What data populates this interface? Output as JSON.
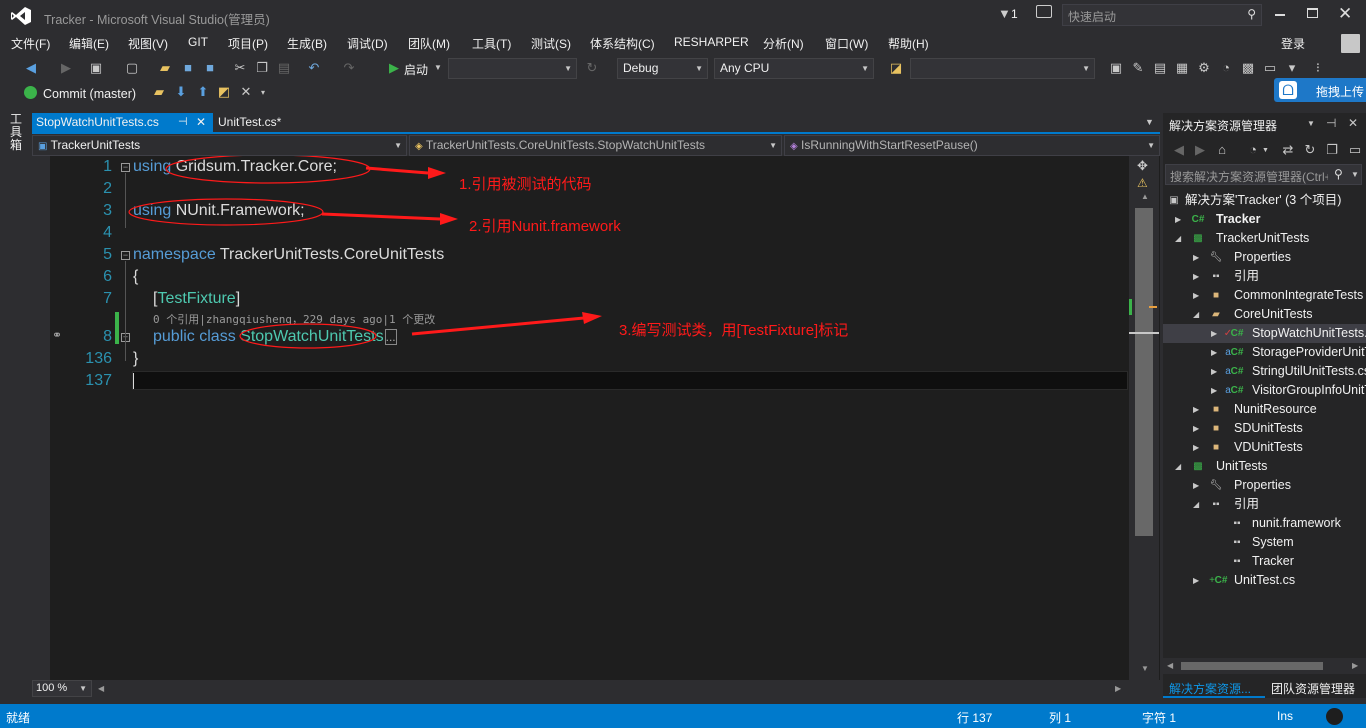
{
  "titlebar": {
    "title": "Tracker - Microsoft Visual Studio(管理员)",
    "notification_count": "1",
    "quick_launch_placeholder": "快速启动"
  },
  "menu": [
    "文件(F)",
    "编辑(E)",
    "视图(V)",
    "GIT",
    "项目(P)",
    "生成(B)",
    "调试(D)",
    "团队(M)",
    "工具(T)",
    "测试(S)",
    "体系结构(C)",
    "RESHARPER",
    "分析(N)",
    "窗口(W)",
    "帮助(H)"
  ],
  "account": {
    "signin": "登录"
  },
  "toolbar": {
    "start_label": "启动",
    "config": "Debug",
    "platform": "Any CPU"
  },
  "git_toolbar": {
    "commit_label": "Commit (master)"
  },
  "upload_badge": "拖拽上传",
  "left_tool_label": "工具箱",
  "tabs": [
    {
      "label": "StopWatchUnitTests.cs",
      "active": true
    },
    {
      "label": "UnitTest.cs*",
      "active": false
    }
  ],
  "navbar": {
    "project": "TrackerUnitTests",
    "class": "TrackerUnitTests.CoreUnitTests.StopWatchUnitTests",
    "member": "IsRunningWithStartResetPause()"
  },
  "code": {
    "line_numbers": [
      "1",
      "2",
      "3",
      "4",
      "5",
      "6",
      "7",
      "8",
      "136",
      "137"
    ],
    "line1_kw": "using",
    "line1_rest": " Gridsum.Tracker.Core;",
    "line3_kw": "using",
    "line3_rest": " NUnit.Framework;",
    "line5_kw": "namespace",
    "line5_rest": " TrackerUnitTests.CoreUnitTests",
    "line6": "{",
    "line7_open": "[",
    "line7_attr": "TestFixture",
    "line7_close": "]",
    "codelens": "0 个引用|zhangqiusheng，229 days ago|1 个更改",
    "line8_kw": "public class",
    "line8_type": "StopWatchUnitTests",
    "line8_ellipsis": "...",
    "line136": "}"
  },
  "annotations": [
    "1.引用被测试的代码",
    "2.引用Nunit.framework",
    "3.编写测试类，用[TestFixture]标记"
  ],
  "zoom": "100 %",
  "solution_explorer": {
    "title": "解决方案资源管理器",
    "search_placeholder": "搜索解决方案资源管理器(Ctrl+;)",
    "nodes": [
      {
        "label": "解决方案'Tracker' (3 个项目)",
        "icon": "solution-icon"
      },
      {
        "label": "Tracker",
        "icon": "csharp-project-icon",
        "bold": true
      },
      {
        "label": "TrackerUnitTests",
        "icon": "test-project-icon"
      },
      {
        "label": "Properties",
        "icon": "wrench-icon"
      },
      {
        "label": "引用",
        "icon": "references-icon"
      },
      {
        "label": "CommonIntegrateTests",
        "icon": "folder-icon"
      },
      {
        "label": "CoreUnitTests",
        "icon": "folder-open-icon"
      },
      {
        "label": "StopWatchUnitTests.cs",
        "icon": "csharp-file-icon"
      },
      {
        "label": "StorageProviderUnitTests.cs",
        "icon": "csharp-file-icon"
      },
      {
        "label": "StringUtilUnitTests.cs",
        "icon": "csharp-file-icon"
      },
      {
        "label": "VisitorGroupInfoUnitTests.cs",
        "icon": "csharp-file-icon"
      },
      {
        "label": "NunitResource",
        "icon": "folder-icon"
      },
      {
        "label": "SDUnitTests",
        "icon": "folder-icon"
      },
      {
        "label": "VDUnitTests",
        "icon": "folder-icon"
      },
      {
        "label": "UnitTests",
        "icon": "test-project-icon"
      },
      {
        "label": "Properties",
        "icon": "wrench-icon"
      },
      {
        "label": "引用",
        "icon": "references-icon"
      },
      {
        "label": "nunit.framework",
        "icon": "reference-icon"
      },
      {
        "label": "System",
        "icon": "reference-icon"
      },
      {
        "label": "Tracker",
        "icon": "reference-icon"
      },
      {
        "label": "UnitTest.cs",
        "icon": "csharp-file-icon"
      }
    ],
    "bottom_tabs": [
      "解决方案资源...",
      "团队资源管理器"
    ]
  },
  "status": {
    "state": "就绪",
    "line": "行 137",
    "col": "列 1",
    "char": "字符 1",
    "mode": "Ins"
  },
  "colors": {
    "accent": "#007acc",
    "annotation_red": "#ff1a1a",
    "keyword": "#569cd6",
    "type": "#4ec9b0",
    "line_number": "#2b91af"
  }
}
